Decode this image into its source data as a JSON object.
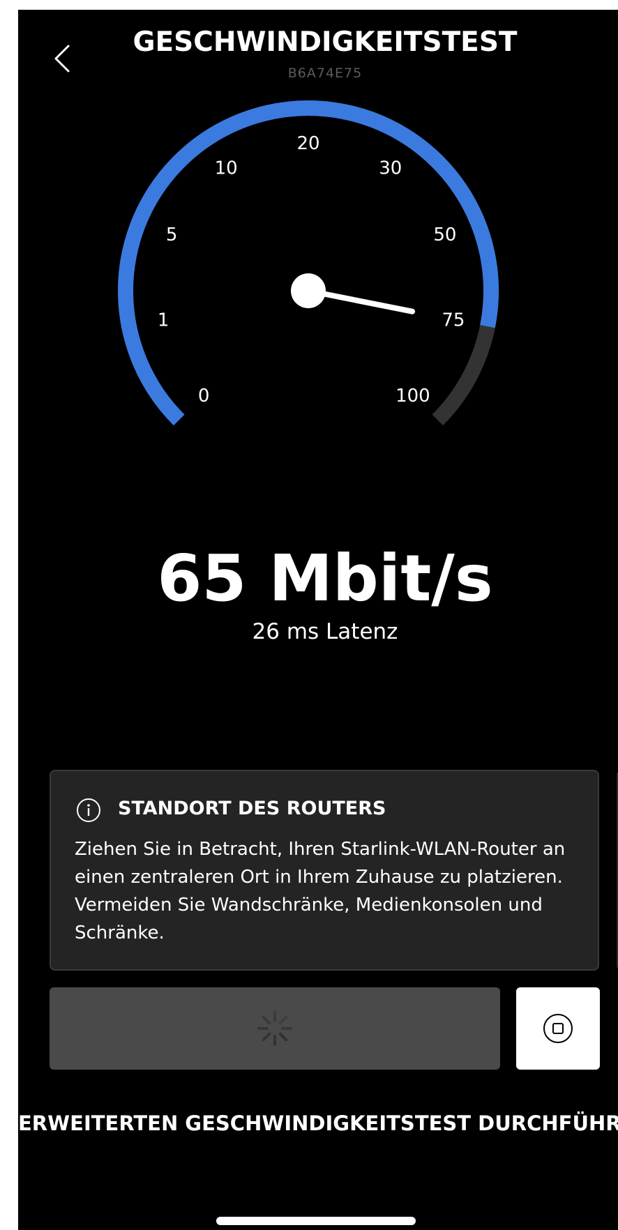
{
  "header": {
    "title": "GESCHWINDIGKEITSTEST",
    "device_id": "B6A74E75"
  },
  "gauge": {
    "tick_labels": [
      "0",
      "1",
      "5",
      "10",
      "20",
      "30",
      "50",
      "75",
      "100"
    ],
    "progress_fraction": 0.875,
    "accent_color": "#3b7be0",
    "track_color": "#333333",
    "needle_fraction": 0.875
  },
  "result": {
    "speed": "65 Mbit/s",
    "latency": "26 ms Latenz"
  },
  "info_card": {
    "icon": "info-icon",
    "title": "STANDORT DES ROUTERS",
    "body": "Ziehen Sie in Betracht, Ihren Starlink-WLAN-Router an einen zentraleren Ort in Ihrem Zuhause zu platzieren. Vermeiden Sie Wandschränke, Medienkonsolen und Schränke."
  },
  "actions": {
    "loading_icon": "spinner-icon",
    "stop_icon": "stop-icon",
    "advanced_label": "ERWEITERTEN GESCHWINDIGKEITSTEST DURCHFÜHREN"
  },
  "icons": {
    "back": "chevron-left-icon"
  }
}
